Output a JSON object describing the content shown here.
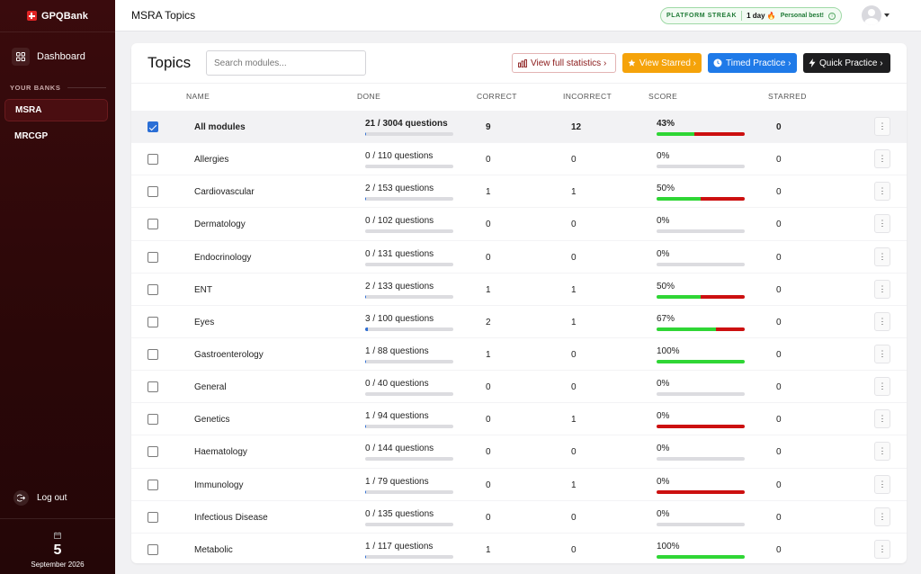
{
  "brand": {
    "name": "GPQBank"
  },
  "sidebar": {
    "dashboard_label": "Dashboard",
    "banks_heading": "YOUR BANKS",
    "banks": [
      {
        "label": "MSRA",
        "active": true
      },
      {
        "label": "MRCGP",
        "active": false
      }
    ],
    "logout_label": "Log out",
    "date": {
      "day": "5",
      "month_year": "September 2026"
    }
  },
  "topbar": {
    "title": "MSRA Topics",
    "streak": {
      "label": "PLATFORM STREAK",
      "days": "1 day 🔥",
      "note": "Personal best!",
      "info": "i"
    }
  },
  "card": {
    "title": "Topics",
    "search_placeholder": "Search modules...",
    "buttons": {
      "stats": "View full statistics ›",
      "starred": "View Starred ›",
      "timed": "Timed Practice ›",
      "quick": "Quick Practice ›"
    },
    "columns": [
      "NAME",
      "DONE",
      "CORRECT",
      "INCORRECT",
      "SCORE",
      "STARRED"
    ],
    "rows": [
      {
        "name": "All modules",
        "done": "21 / 3004 questions",
        "done_frac": 0.007,
        "correct": "9",
        "incorrect": "12",
        "score": "43%",
        "green": 0.43,
        "red": 0.57,
        "starred": "0",
        "checked": true,
        "total": true
      },
      {
        "name": "Allergies",
        "done": "0 / 110 questions",
        "done_frac": 0,
        "correct": "0",
        "incorrect": "0",
        "score": "0%",
        "green": 0,
        "red": 0,
        "starred": "0",
        "checked": false
      },
      {
        "name": "Cardiovascular",
        "done": "2 / 153 questions",
        "done_frac": 0.013,
        "correct": "1",
        "incorrect": "1",
        "score": "50%",
        "green": 0.5,
        "red": 0.5,
        "starred": "0",
        "checked": false
      },
      {
        "name": "Dermatology",
        "done": "0 / 102 questions",
        "done_frac": 0,
        "correct": "0",
        "incorrect": "0",
        "score": "0%",
        "green": 0,
        "red": 0,
        "starred": "0",
        "checked": false
      },
      {
        "name": "Endocrinology",
        "done": "0 / 131 questions",
        "done_frac": 0,
        "correct": "0",
        "incorrect": "0",
        "score": "0%",
        "green": 0,
        "red": 0,
        "starred": "0",
        "checked": false
      },
      {
        "name": "ENT",
        "done": "2 / 133 questions",
        "done_frac": 0.015,
        "correct": "1",
        "incorrect": "1",
        "score": "50%",
        "green": 0.5,
        "red": 0.5,
        "starred": "0",
        "checked": false
      },
      {
        "name": "Eyes",
        "done": "3 / 100 questions",
        "done_frac": 0.03,
        "correct": "2",
        "incorrect": "1",
        "score": "67%",
        "green": 0.67,
        "red": 0.33,
        "starred": "0",
        "checked": false
      },
      {
        "name": "Gastroenterology",
        "done": "1 / 88 questions",
        "done_frac": 0.011,
        "correct": "1",
        "incorrect": "0",
        "score": "100%",
        "green": 1,
        "red": 0,
        "starred": "0",
        "checked": false
      },
      {
        "name": "General",
        "done": "0 / 40 questions",
        "done_frac": 0,
        "correct": "0",
        "incorrect": "0",
        "score": "0%",
        "green": 0,
        "red": 0,
        "starred": "0",
        "checked": false
      },
      {
        "name": "Genetics",
        "done": "1 / 94 questions",
        "done_frac": 0.011,
        "correct": "0",
        "incorrect": "1",
        "score": "0%",
        "green": 0,
        "red": 1,
        "starred": "0",
        "checked": false
      },
      {
        "name": "Haematology",
        "done": "0 / 144 questions",
        "done_frac": 0,
        "correct": "0",
        "incorrect": "0",
        "score": "0%",
        "green": 0,
        "red": 0,
        "starred": "0",
        "checked": false
      },
      {
        "name": "Immunology",
        "done": "1 / 79 questions",
        "done_frac": 0.013,
        "correct": "0",
        "incorrect": "1",
        "score": "0%",
        "green": 0,
        "red": 1,
        "starred": "0",
        "checked": false
      },
      {
        "name": "Infectious Disease",
        "done": "0 / 135 questions",
        "done_frac": 0,
        "correct": "0",
        "incorrect": "0",
        "score": "0%",
        "green": 0,
        "red": 0,
        "starred": "0",
        "checked": false
      },
      {
        "name": "Metabolic",
        "done": "1 / 117 questions",
        "done_frac": 0.009,
        "correct": "1",
        "incorrect": "0",
        "score": "100%",
        "green": 1,
        "red": 0,
        "starred": "0",
        "checked": false
      }
    ]
  },
  "colors": {
    "sidebar": "#2a0708",
    "green": "#2fd635",
    "red": "#cc1010",
    "blue": "#1f7ae8",
    "orange": "#f5a30a"
  }
}
